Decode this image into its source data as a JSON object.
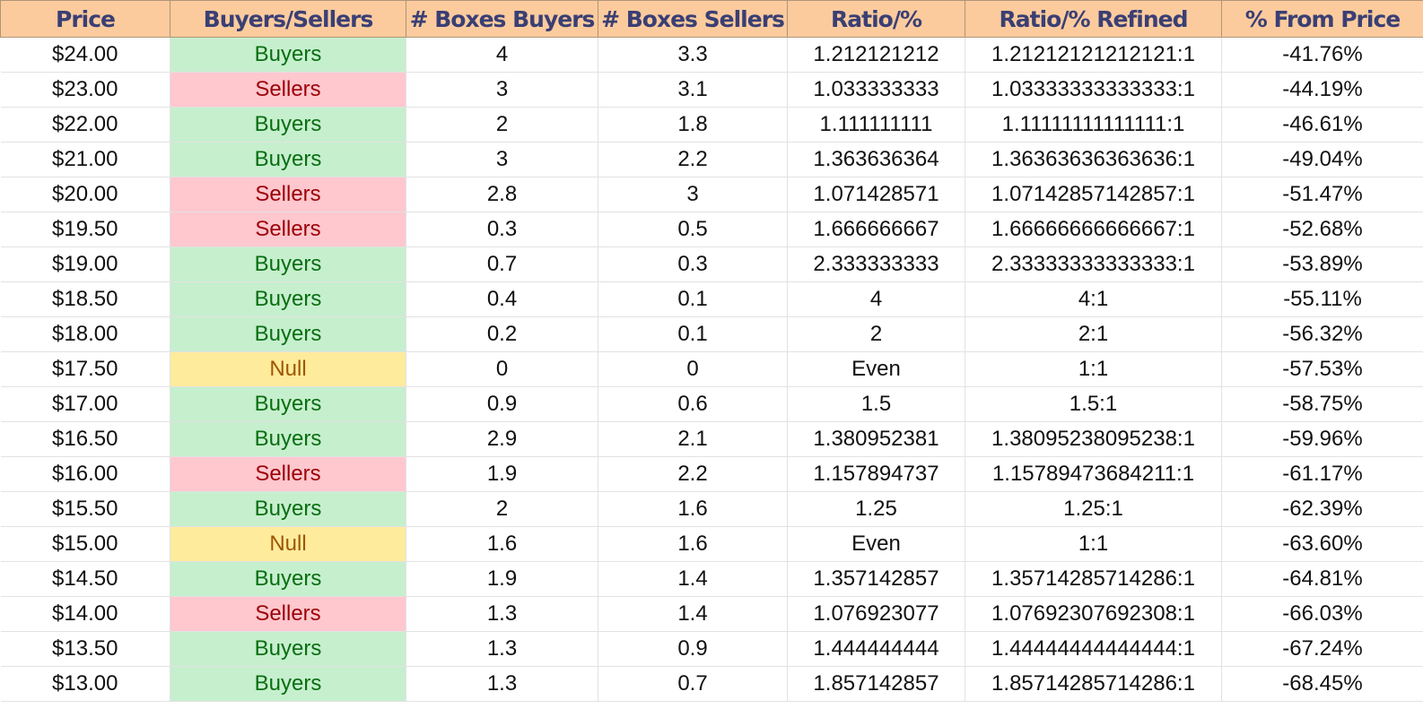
{
  "colors": {
    "header_bg": "#fccb9d",
    "header_text": "#3a3f74",
    "buyers_bg": "#c6efce",
    "buyers_text": "#086e10",
    "sellers_bg": "#ffc7ce",
    "sellers_text": "#9c0006",
    "null_bg": "#ffeb9c",
    "null_text": "#9c5700"
  },
  "headers": [
    "Price",
    "Buyers/Sellers",
    "# Boxes Buyers",
    "# Boxes Sellers",
    "Ratio/%",
    "Ratio/% Refined",
    "% From Price"
  ],
  "rows": [
    {
      "price": "$24.00",
      "side": "Buyers",
      "boxes_buyers": "4",
      "boxes_sellers": "3.3",
      "ratio": "1.212121212",
      "refined": "1.21212121212121:1",
      "from_price": "-41.76%"
    },
    {
      "price": "$23.00",
      "side": "Sellers",
      "boxes_buyers": "3",
      "boxes_sellers": "3.1",
      "ratio": "1.033333333",
      "refined": "1.03333333333333:1",
      "from_price": "-44.19%"
    },
    {
      "price": "$22.00",
      "side": "Buyers",
      "boxes_buyers": "2",
      "boxes_sellers": "1.8",
      "ratio": "1.111111111",
      "refined": "1.11111111111111:1",
      "from_price": "-46.61%"
    },
    {
      "price": "$21.00",
      "side": "Buyers",
      "boxes_buyers": "3",
      "boxes_sellers": "2.2",
      "ratio": "1.363636364",
      "refined": "1.36363636363636:1",
      "from_price": "-49.04%"
    },
    {
      "price": "$20.00",
      "side": "Sellers",
      "boxes_buyers": "2.8",
      "boxes_sellers": "3",
      "ratio": "1.071428571",
      "refined": "1.07142857142857:1",
      "from_price": "-51.47%"
    },
    {
      "price": "$19.50",
      "side": "Sellers",
      "boxes_buyers": "0.3",
      "boxes_sellers": "0.5",
      "ratio": "1.666666667",
      "refined": "1.66666666666667:1",
      "from_price": "-52.68%"
    },
    {
      "price": "$19.00",
      "side": "Buyers",
      "boxes_buyers": "0.7",
      "boxes_sellers": "0.3",
      "ratio": "2.333333333",
      "refined": "2.33333333333333:1",
      "from_price": "-53.89%"
    },
    {
      "price": "$18.50",
      "side": "Buyers",
      "boxes_buyers": "0.4",
      "boxes_sellers": "0.1",
      "ratio": "4",
      "refined": "4:1",
      "from_price": "-55.11%"
    },
    {
      "price": "$18.00",
      "side": "Buyers",
      "boxes_buyers": "0.2",
      "boxes_sellers": "0.1",
      "ratio": "2",
      "refined": "2:1",
      "from_price": "-56.32%"
    },
    {
      "price": "$17.50",
      "side": "Null",
      "boxes_buyers": "0",
      "boxes_sellers": "0",
      "ratio": "Even",
      "refined": "1:1",
      "from_price": "-57.53%"
    },
    {
      "price": "$17.00",
      "side": "Buyers",
      "boxes_buyers": "0.9",
      "boxes_sellers": "0.6",
      "ratio": "1.5",
      "refined": "1.5:1",
      "from_price": "-58.75%"
    },
    {
      "price": "$16.50",
      "side": "Buyers",
      "boxes_buyers": "2.9",
      "boxes_sellers": "2.1",
      "ratio": "1.380952381",
      "refined": "1.38095238095238:1",
      "from_price": "-59.96%"
    },
    {
      "price": "$16.00",
      "side": "Sellers",
      "boxes_buyers": "1.9",
      "boxes_sellers": "2.2",
      "ratio": "1.157894737",
      "refined": "1.15789473684211:1",
      "from_price": "-61.17%"
    },
    {
      "price": "$15.50",
      "side": "Buyers",
      "boxes_buyers": "2",
      "boxes_sellers": "1.6",
      "ratio": "1.25",
      "refined": "1.25:1",
      "from_price": "-62.39%"
    },
    {
      "price": "$15.00",
      "side": "Null",
      "boxes_buyers": "1.6",
      "boxes_sellers": "1.6",
      "ratio": "Even",
      "refined": "1:1",
      "from_price": "-63.60%"
    },
    {
      "price": "$14.50",
      "side": "Buyers",
      "boxes_buyers": "1.9",
      "boxes_sellers": "1.4",
      "ratio": "1.357142857",
      "refined": "1.35714285714286:1",
      "from_price": "-64.81%"
    },
    {
      "price": "$14.00",
      "side": "Sellers",
      "boxes_buyers": "1.3",
      "boxes_sellers": "1.4",
      "ratio": "1.076923077",
      "refined": "1.07692307692308:1",
      "from_price": "-66.03%"
    },
    {
      "price": "$13.50",
      "side": "Buyers",
      "boxes_buyers": "1.3",
      "boxes_sellers": "0.9",
      "ratio": "1.444444444",
      "refined": "1.44444444444444:1",
      "from_price": "-67.24%"
    },
    {
      "price": "$13.00",
      "side": "Buyers",
      "boxes_buyers": "1.3",
      "boxes_sellers": "0.7",
      "ratio": "1.857142857",
      "refined": "1.85714285714286:1",
      "from_price": "-68.45%"
    }
  ]
}
